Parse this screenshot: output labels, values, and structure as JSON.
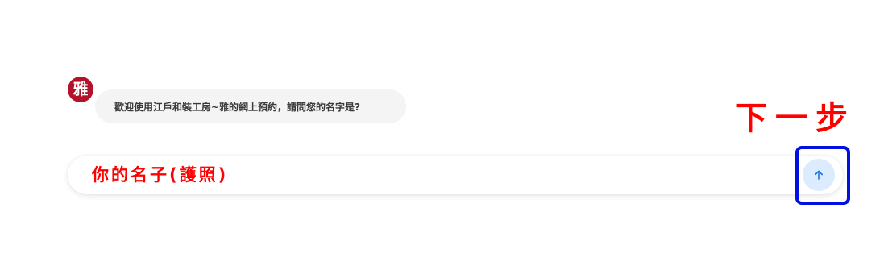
{
  "chat": {
    "avatar_text": "雅",
    "message": "歡迎使用江戶和裝工房~雅的網上預約，請問您的名字是?"
  },
  "composer": {
    "placeholder": "你的名子(護照)"
  },
  "annotation": {
    "next_step": "下一步"
  },
  "icons": {
    "send": "arrow-up-icon"
  },
  "colors": {
    "avatar_bg": "#b3122b",
    "annotation_red": "#ff0000",
    "highlight_blue": "#0010e0",
    "send_button_bg": "#dcebfd",
    "send_arrow": "#1a73e8"
  }
}
